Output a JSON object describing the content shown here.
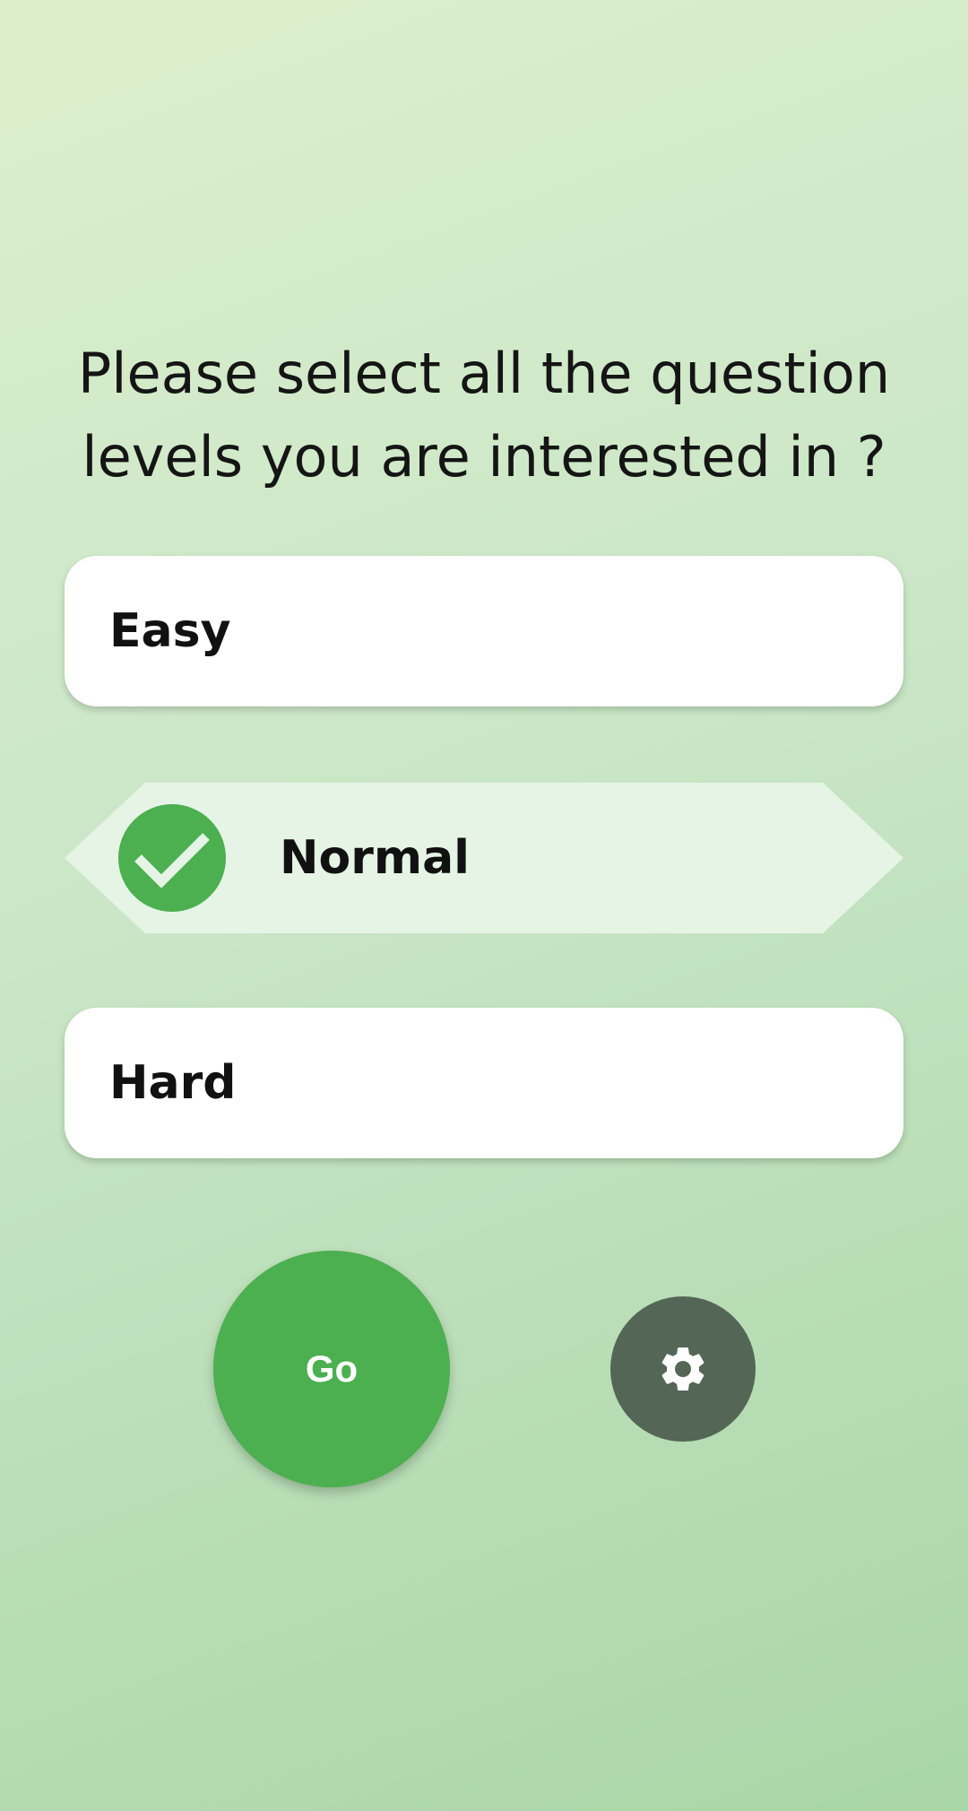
{
  "prompt": {
    "line1": "Please select all the question",
    "line2": "levels you are interested in ?"
  },
  "options": [
    {
      "label": "Easy",
      "selected": false
    },
    {
      "label": "Normal",
      "selected": true
    },
    {
      "label": "Hard",
      "selected": false
    }
  ],
  "actions": {
    "go_label": "Go",
    "settings_icon": "gear-icon"
  },
  "colors": {
    "accent": "#4caf50",
    "selected_bg": "#e6f4e6",
    "settings_bg": "#546655",
    "card_bg": "#ffffff"
  }
}
